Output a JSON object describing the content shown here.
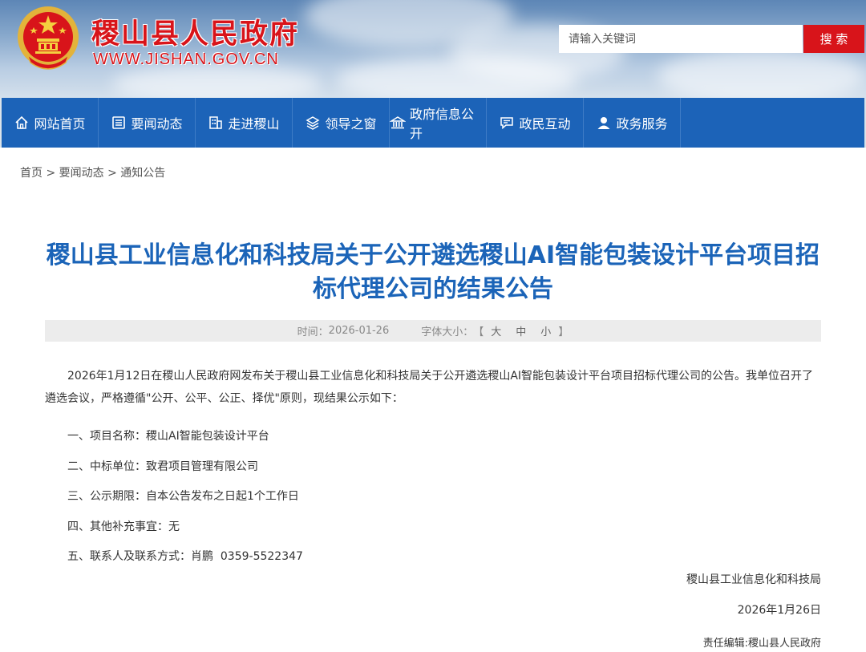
{
  "header": {
    "site_title": "稷山县人民政府",
    "site_url": "WWW.JISHAN.GOV.CN",
    "search_placeholder": "请输入关键词",
    "search_button": "搜 索"
  },
  "nav": {
    "items": [
      {
        "label": "网站首页",
        "icon": "home-icon"
      },
      {
        "label": "要闻动态",
        "icon": "news-icon"
      },
      {
        "label": "走进稷山",
        "icon": "building-icon"
      },
      {
        "label": "领导之窗",
        "icon": "layers-icon"
      },
      {
        "label": "政府信息公开",
        "icon": "bank-icon"
      },
      {
        "label": "政民互动",
        "icon": "chat-icon"
      },
      {
        "label": "政务服务",
        "icon": "user-service-icon"
      }
    ]
  },
  "breadcrumb": {
    "home": "首页",
    "section": "要闻动态",
    "current": "通知公告",
    "separator": " > "
  },
  "article": {
    "title": "稷山县工业信息化和科技局关于公开遴选稷山AI智能包装设计平台项目招标代理公司的结果公告",
    "time_label": "时间：",
    "date": "2026-01-26",
    "font_size_label": "字体大小：",
    "font_bracket_open": "【",
    "font_large": "大",
    "font_medium": "中",
    "font_small": "小",
    "font_bracket_close": "】",
    "intro": "2026年1月12日在稷山人民政府网发布关于稷山县工业信息化和科技局关于公开遴选稷山AI智能包装设计平台项目招标代理公司的公告。我单位召开了遴选会议，严格遵循\"公开、公平、公正、择优\"原则，现结果公示如下：",
    "items": [
      "一、项目名称：稷山AI智能包装设计平台",
      "二、中标单位：致君项目管理有限公司",
      "三、公示期限：自本公告发布之日起1个工作日",
      "四、其他补充事宜：无",
      "五、联系人及联系方式：肖鹏  0359-5522347"
    ],
    "signature_org": "稷山县工业信息化和科技局",
    "signature_date": "2026年1月26日",
    "editor": "责任编辑:稷山县人民政府"
  },
  "colors": {
    "brand_red": "#d8141a",
    "nav_blue": "#1c63b8",
    "title_blue": "#1b64b8"
  }
}
